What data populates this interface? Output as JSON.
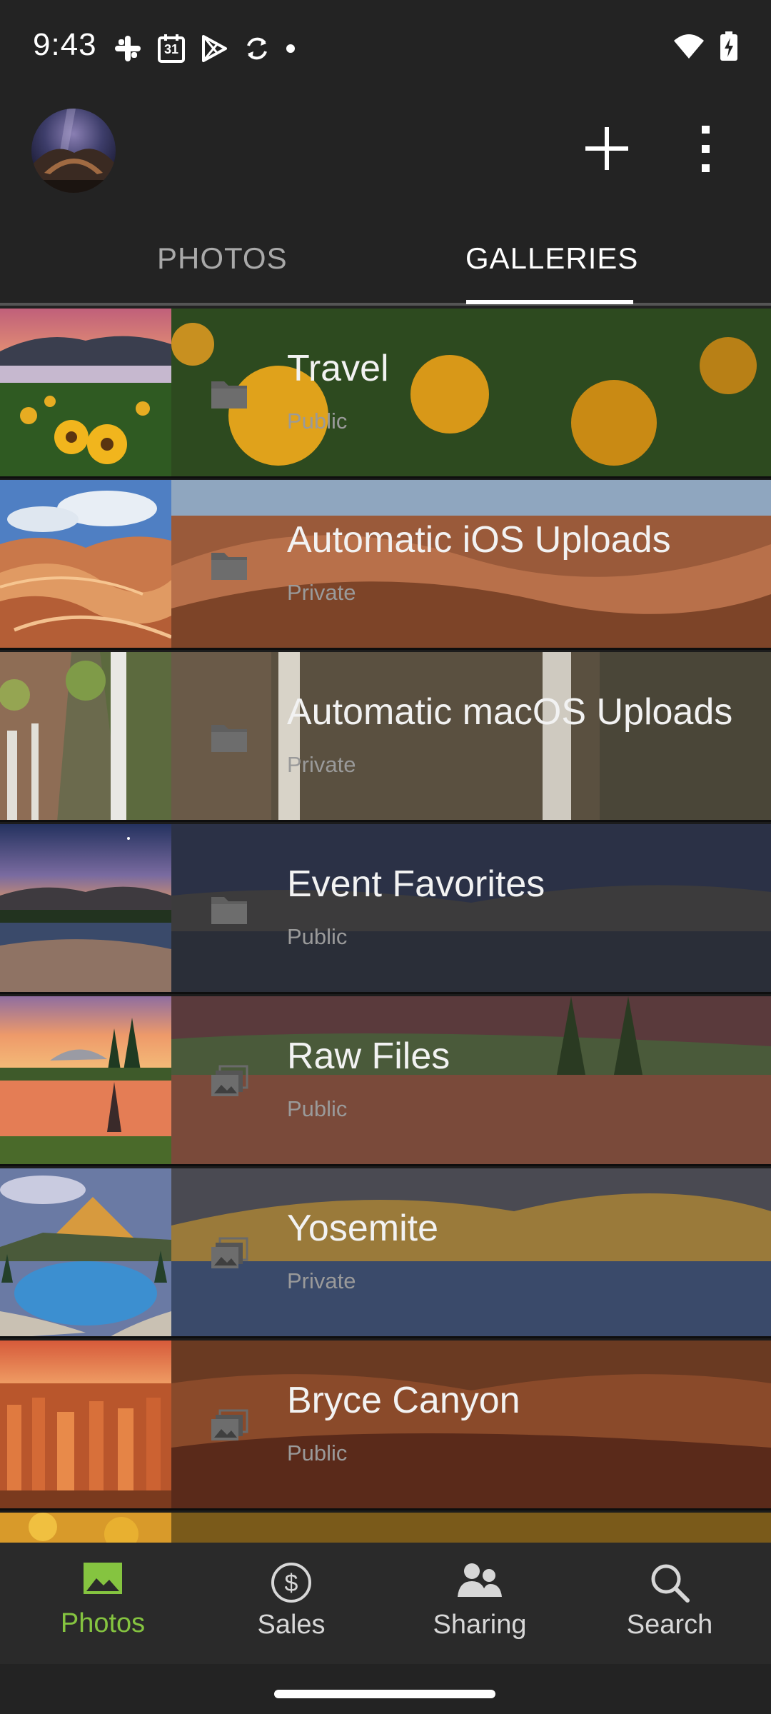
{
  "status_bar": {
    "time": "9:43",
    "left_icons": [
      "slack-icon",
      "calendar-icon",
      "play-store-icon",
      "sync-icon",
      "dot-icon"
    ],
    "calendar_day": "31",
    "right_icons": [
      "wifi-icon",
      "battery-charging-icon"
    ]
  },
  "app_bar": {
    "avatar_icon": "avatar",
    "add_icon": "plus-icon",
    "menu_icon": "more-vertical-icon"
  },
  "tabs": [
    {
      "label": "PHOTOS",
      "selected": false
    },
    {
      "label": "GALLERIES",
      "selected": true
    }
  ],
  "galleries": [
    {
      "title": "Travel",
      "privacy": "Public",
      "icon": "folder-icon"
    },
    {
      "title": "Automatic iOS Uploads",
      "privacy": "Private",
      "icon": "folder-icon"
    },
    {
      "title": "Automatic macOS Uploads",
      "privacy": "Private",
      "icon": "folder-icon"
    },
    {
      "title": "Event Favorites",
      "privacy": "Public",
      "icon": "folder-icon"
    },
    {
      "title": "Raw Files",
      "privacy": "Public",
      "icon": "gallery-stack-icon"
    },
    {
      "title": "Yosemite",
      "privacy": "Private",
      "icon": "gallery-stack-icon"
    },
    {
      "title": "Bryce Canyon",
      "privacy": "Public",
      "icon": "gallery-stack-icon"
    }
  ],
  "bottom_nav": [
    {
      "label": "Photos",
      "icon": "photo-icon",
      "active": true
    },
    {
      "label": "Sales",
      "icon": "dollar-icon",
      "active": false
    },
    {
      "label": "Sharing",
      "icon": "people-icon",
      "active": false
    },
    {
      "label": "Search",
      "icon": "search-icon",
      "active": false
    }
  ],
  "colors": {
    "accent": "#85c440",
    "background": "#232323",
    "nav_background": "#2a2a2a",
    "tab_selected": "#ffffff",
    "tab_unselected": "#a9a9a9"
  }
}
